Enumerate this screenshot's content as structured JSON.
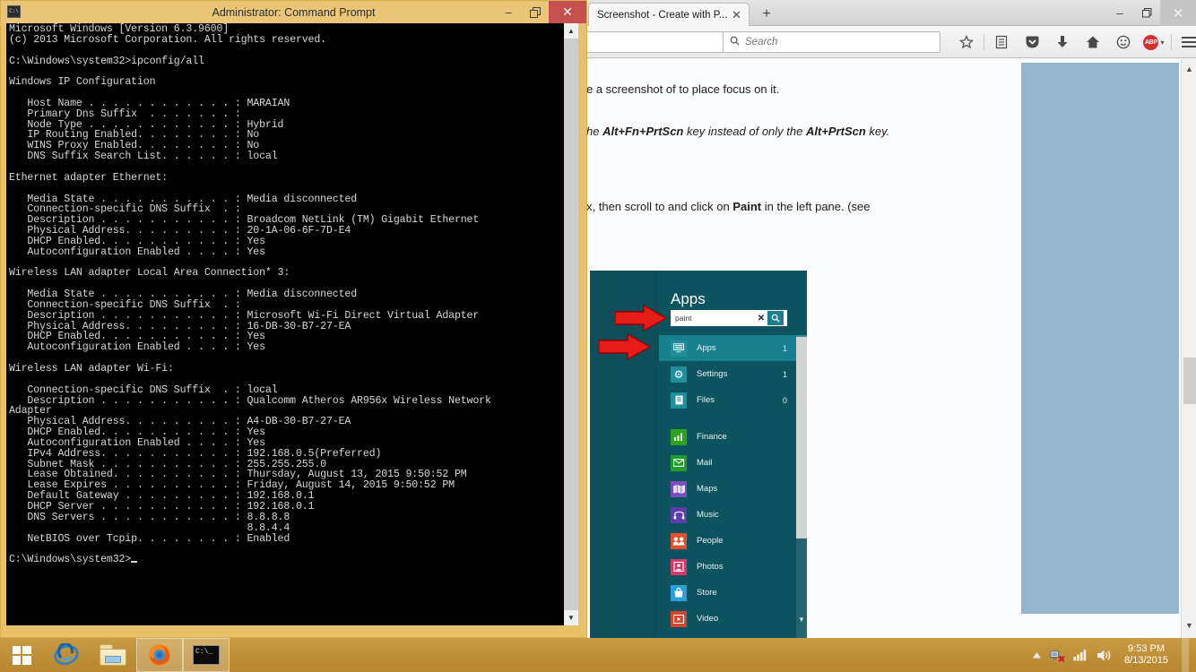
{
  "browser": {
    "tab": {
      "title": "Screenshot - Create with P...",
      "close_label": "✕"
    },
    "new_tab_label": "+",
    "window_controls": {
      "minimize": "–",
      "restore": "❐",
      "close": "✕"
    },
    "urlbar": {
      "value": "",
      "dropdown_glyph": "▽",
      "reload_glyph": "⟳"
    },
    "search": {
      "value": "",
      "placeholder": "Search",
      "icon": "⌕"
    },
    "toolbar_icons": [
      {
        "name": "bookmark-star-icon",
        "glyph": "☆"
      },
      {
        "name": "reading-list-icon",
        "glyph": "Ὄb"
      },
      {
        "name": "pocket-icon",
        "glyph": "♥"
      },
      {
        "name": "downloads-icon",
        "glyph": "⬇"
      },
      {
        "name": "home-icon",
        "glyph": "⌂"
      },
      {
        "name": "chat-icon",
        "glyph": "☺"
      },
      {
        "name": "adblock-icon",
        "glyph": "ABP"
      },
      {
        "name": "menu-icon",
        "glyph": "☰"
      }
    ],
    "adblock_label": "ABP",
    "adblock_caret": "▾",
    "page": {
      "line1": "e a screenshot of to place focus on it.",
      "line2_pre": "he ",
      "line2_bold1": "Alt+Fn+PrtScn",
      "line2_mid": " key instead of only the ",
      "line2_bold2": "Alt+PrtScn",
      "line2_post": " key.",
      "line3_pre": "x, then scroll to and click on ",
      "line3_bold": "Paint",
      "line3_post": " in the left pane. (see",
      "scroll_up_glyph": "▲",
      "scroll_down_glyph": "▼"
    }
  },
  "win8_search": {
    "title": "Apps",
    "search_value": "paint",
    "search_placeholder": "",
    "clear_glyph": "✕",
    "go_glyph": "⌕",
    "categories": [
      {
        "name": "Apps",
        "label": "Apps",
        "count": "1",
        "color": "#1f8f9e",
        "glyph": "⌸",
        "active": true
      },
      {
        "name": "Settings",
        "label": "Settings",
        "count": "1",
        "color": "#1f8f9e",
        "glyph": "⚙",
        "active": false
      },
      {
        "name": "Files",
        "label": "Files",
        "count": "0",
        "color": "#1f8f9e",
        "glyph": "Ὄ4",
        "active": false
      }
    ],
    "apps": [
      {
        "label": "Finance",
        "color": "#2aa31f",
        "glyph": "Ὄ8"
      },
      {
        "label": "Mail",
        "color": "#1f9c2a",
        "glyph": "✉"
      },
      {
        "label": "Maps",
        "color": "#7a4fbd",
        "glyph": "Ὗa"
      },
      {
        "label": "Music",
        "color": "#5b3fa8",
        "glyph": "♫"
      },
      {
        "label": "People",
        "color": "#e0502b",
        "glyph": "὆5"
      },
      {
        "label": "Photos",
        "color": "#d63b6f",
        "glyph": "Ὓc"
      },
      {
        "label": "Store",
        "color": "#2e9fd6",
        "glyph": "Ὤd"
      },
      {
        "label": "Video",
        "color": "#d4452e",
        "glyph": "▶"
      }
    ],
    "scroll_up_glyph": "▲",
    "scroll_down_glyph": "▼",
    "accent_color": "#0e5460",
    "highlight_color": "#18808f"
  },
  "command_prompt": {
    "title": "Administrator: Command Prompt",
    "window_controls": {
      "minimize": "–",
      "restore": "❐",
      "close": "✕"
    },
    "sys_icon_label": "C:\\",
    "output": "Microsoft Windows [Version 6.3.9600]\n(c) 2013 Microsoft Corporation. All rights reserved.\n\nC:\\Windows\\system32>ipconfig/all\n\nWindows IP Configuration\n\n   Host Name . . . . . . . . . . . . : MARAIAN\n   Primary Dns Suffix  . . . . . . . :\n   Node Type . . . . . . . . . . . . : Hybrid\n   IP Routing Enabled. . . . . . . . : No\n   WINS Proxy Enabled. . . . . . . . : No\n   DNS Suffix Search List. . . . . . : local\n\nEthernet adapter Ethernet:\n\n   Media State . . . . . . . . . . . : Media disconnected\n   Connection-specific DNS Suffix  . :\n   Description . . . . . . . . . . . : Broadcom NetLink (TM) Gigabit Ethernet\n   Physical Address. . . . . . . . . : 20-1A-06-6F-7D-E4\n   DHCP Enabled. . . . . . . . . . . : Yes\n   Autoconfiguration Enabled . . . . : Yes\n\nWireless LAN adapter Local Area Connection* 3:\n\n   Media State . . . . . . . . . . . : Media disconnected\n   Connection-specific DNS Suffix  . :\n   Description . . . . . . . . . . . : Microsoft Wi-Fi Direct Virtual Adapter\n   Physical Address. . . . . . . . . : 16-DB-30-B7-27-EA\n   DHCP Enabled. . . . . . . . . . . : Yes\n   Autoconfiguration Enabled . . . . : Yes\n\nWireless LAN adapter Wi-Fi:\n\n   Connection-specific DNS Suffix  . : local\n   Description . . . . . . . . . . . : Qualcomm Atheros AR956x Wireless Network\nAdapter\n   Physical Address. . . . . . . . . : A4-DB-30-B7-27-EA\n   DHCP Enabled. . . . . . . . . . . : Yes\n   Autoconfiguration Enabled . . . . : Yes\n   IPv4 Address. . . . . . . . . . . : 192.168.0.5(Preferred)\n   Subnet Mask . . . . . . . . . . . : 255.255.255.0\n   Lease Obtained. . . . . . . . . . : Thursday, August 13, 2015 9:50:52 PM\n   Lease Expires . . . . . . . . . . : Friday, August 14, 2015 9:50:52 PM\n   Default Gateway . . . . . . . . . : 192.168.0.1\n   DHCP Server . . . . . . . . . . . : 192.168.0.1\n   DNS Servers . . . . . . . . . . . : 8.8.8.8\n                                       8.8.4.4\n   NetBIOS over Tcpip. . . . . . . . : Enabled\n\nC:\\Windows\\system32>",
    "scroll_up_glyph": "▲",
    "scroll_down_glyph": "▼"
  },
  "image_info": "1270x798  74kb  JPEG",
  "taskbar": {
    "start_label": "Start",
    "items": [
      {
        "name": "internet-explorer",
        "label": "Internet Explorer",
        "active": false
      },
      {
        "name": "file-explorer",
        "label": "File Explorer",
        "active": false
      },
      {
        "name": "firefox",
        "label": "Mozilla Firefox",
        "active": true
      },
      {
        "name": "command-prompt",
        "label": "Command Prompt",
        "active": true
      }
    ],
    "tray": {
      "show_hidden_glyph": "▲",
      "network_glyph": "὚7",
      "signal_glyph": "▐",
      "volume_glyph": "ὐa",
      "time": "9:53 PM",
      "date": "8/13/2015"
    }
  }
}
